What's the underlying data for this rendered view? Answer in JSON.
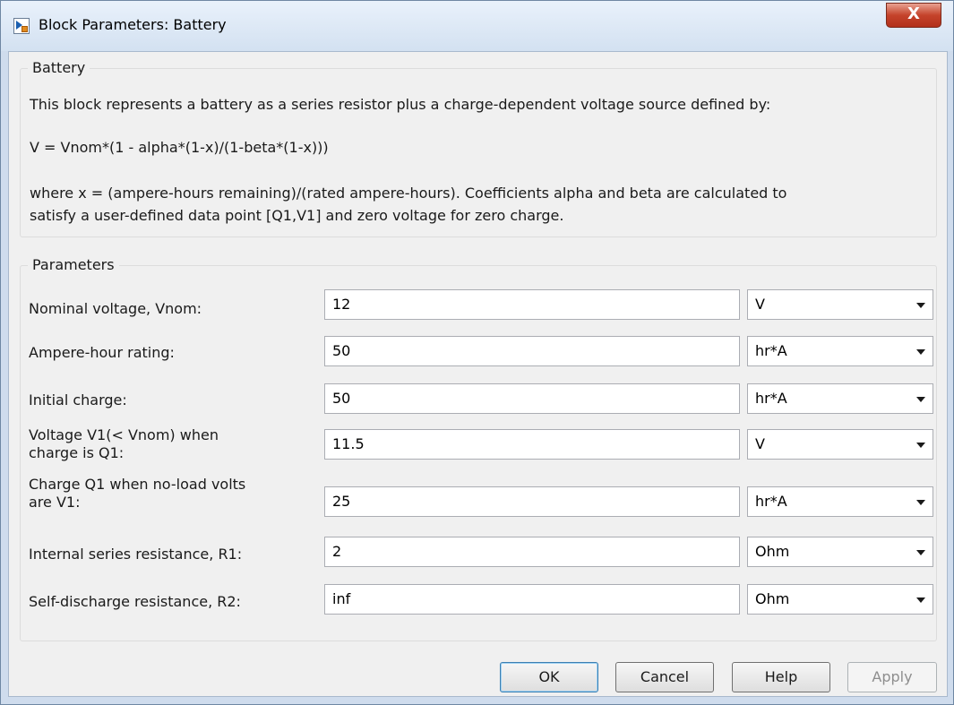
{
  "window": {
    "title": "Block Parameters: Battery",
    "close_glyph": "X"
  },
  "description_group": {
    "legend": "Battery",
    "line1": "This block represents a battery as a series resistor plus a charge-dependent voltage source defined by:",
    "formula": "V = Vnom*(1 - alpha*(1-x)/(1-beta*(1-x)))",
    "line3a": "where x = (ampere-hours remaining)/(rated ampere-hours). Coefficients alpha and beta are calculated to",
    "line3b": "satisfy a user-defined data point [Q1,V1] and zero voltage for zero charge."
  },
  "parameters": {
    "legend": "Parameters",
    "rows": [
      {
        "label_1": "Nominal voltage, Vnom:",
        "label_2": "",
        "value": "12",
        "unit": "V"
      },
      {
        "label_1": "Ampere-hour rating:",
        "label_2": "",
        "value": "50",
        "unit": "hr*A"
      },
      {
        "label_1": "Initial charge:",
        "label_2": "",
        "value": "50",
        "unit": "hr*A"
      },
      {
        "label_1": "Voltage V1(< Vnom) when",
        "label_2": "charge is Q1:",
        "value": "11.5",
        "unit": "V"
      },
      {
        "label_1": "Charge Q1 when no-load volts",
        "label_2": "are V1:",
        "value": "25",
        "unit": "hr*A"
      },
      {
        "label_1": "Internal series resistance, R1:",
        "label_2": "",
        "value": "2",
        "unit": "Ohm"
      },
      {
        "label_1": "Self-discharge resistance, R2:",
        "label_2": "",
        "value": "inf",
        "unit": "Ohm"
      }
    ]
  },
  "buttons": {
    "ok": "OK",
    "cancel": "Cancel",
    "help": "Help",
    "apply": "Apply"
  }
}
